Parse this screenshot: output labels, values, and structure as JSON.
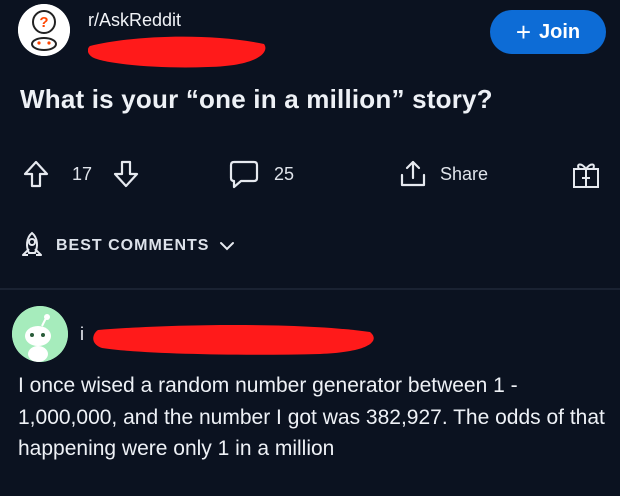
{
  "header": {
    "subreddit": "r/AskReddit",
    "join_label": "Join"
  },
  "post": {
    "title": "What is your “one in a million” story?",
    "upvotes": "17",
    "comments": "25",
    "share_label": "Share"
  },
  "sort": {
    "label": "BEST COMMENTS"
  },
  "comment": {
    "author_initial": "i",
    "body": "I once wised a random number generator between 1 - 1,000,000, and the number I got was 382,927. The odds of that happening were only 1 in a million"
  },
  "colors": {
    "background": "#0b1220",
    "join_button": "#0d6cd6",
    "redaction": "#ff1a1a",
    "comment_avatar": "#a6ecbc"
  }
}
